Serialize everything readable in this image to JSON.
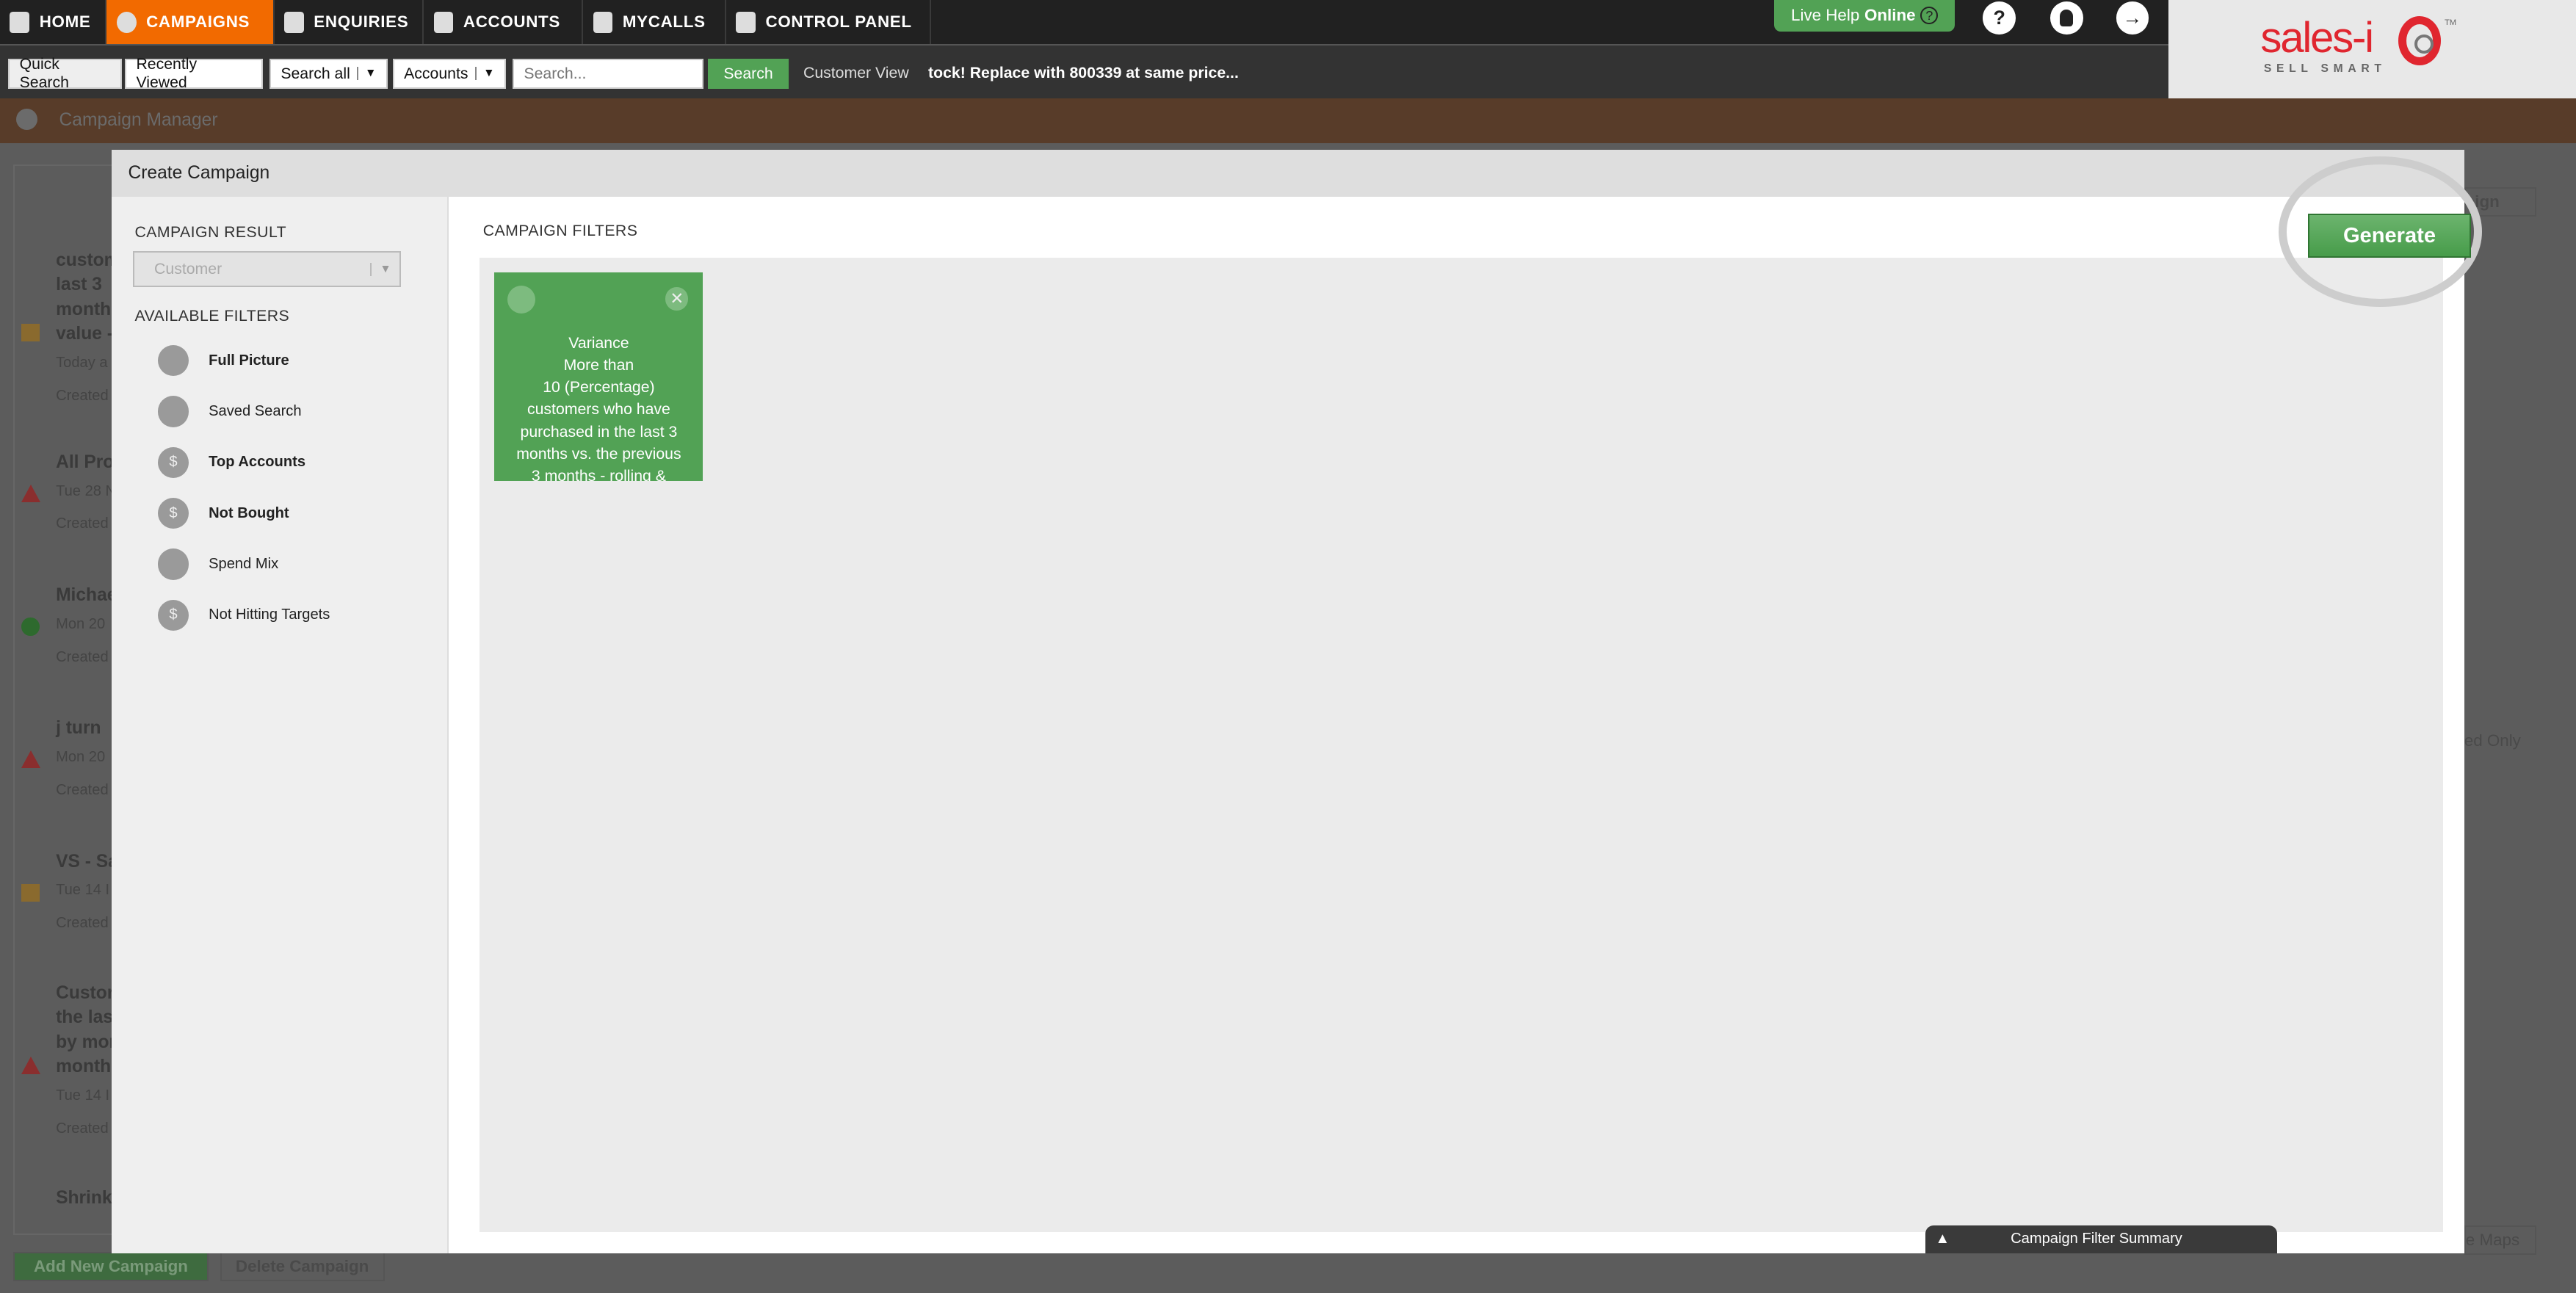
{
  "nav": {
    "items": [
      {
        "label": "HOME",
        "icon": "home-icon"
      },
      {
        "label": "CAMPAIGNS",
        "icon": "campaigns-icon",
        "active": true
      },
      {
        "label": "ENQUIRIES",
        "icon": "enquiries-icon"
      },
      {
        "label": "ACCOUNTS",
        "icon": "accounts-icon"
      },
      {
        "label": "MYCALLS",
        "icon": "mycalls-icon"
      },
      {
        "label": "CONTROL PANEL",
        "icon": "control-panel-icon"
      }
    ],
    "live_help": "Live Help",
    "live_help_status": "Online",
    "help": "?",
    "accent": "#f26a00"
  },
  "search": {
    "quick_search": "Quick Search",
    "recently_viewed": "Recently Viewed",
    "scope": "Search all",
    "entity": "Accounts",
    "placeholder": "Search...",
    "button": "Search",
    "customer_view": "Customer View",
    "ticker": "tock! Replace with 800339 at same price..."
  },
  "logo": {
    "text": "sales-i",
    "tagline": "SELL SMART",
    "tm": "TM"
  },
  "page": {
    "title": "Campaign Manager"
  },
  "background": {
    "campaigns": [
      {
        "title_lines": [
          "custom",
          "last 3",
          "months",
          "value -"
        ],
        "date": "Today a",
        "created": "Created",
        "status": "amber"
      },
      {
        "title_lines": [
          "All Pro"
        ],
        "date": "Tue 28 N",
        "created": "Created",
        "status": "red"
      },
      {
        "title_lines": [
          "Michae"
        ],
        "date": "Mon 20",
        "created": "Created",
        "status": "green"
      },
      {
        "title_lines": [
          "j turn"
        ],
        "date": "Mon 20",
        "created": "Created",
        "status": "red"
      },
      {
        "title_lines": [
          "VS - Sa"
        ],
        "date": "Tue 14 I",
        "created": "Created",
        "status": "amber"
      },
      {
        "title_lines": [
          "Custor",
          "the las",
          "by mor",
          "months"
        ],
        "date": "Tue 14 I",
        "created": "Created",
        "status": "red"
      },
      {
        "title_lines": [
          "Shrink"
        ],
        "date": "",
        "created": "",
        "status": ""
      }
    ],
    "add_new": "Add New Campaign",
    "delete": "Delete Campaign",
    "right_button": "aign",
    "only_label": "ed Only",
    "maps": "e Maps"
  },
  "modal": {
    "title": "Create Campaign",
    "campaign_result_label": "CAMPAIGN RESULT",
    "campaign_result_value": "Customer",
    "available_filters_label": "AVAILABLE FILTERS",
    "filters": [
      {
        "label": "Full Picture",
        "icon": "full-picture-icon"
      },
      {
        "label": "Saved Search",
        "icon": "bank-icon"
      },
      {
        "label": "Top Accounts",
        "icon": "dollar-trend-icon"
      },
      {
        "label": "Not Bought",
        "icon": "dollar-trend-icon"
      },
      {
        "label": "Spend Mix",
        "icon": "spend-mix-icon"
      },
      {
        "label": "Not Hitting Targets",
        "icon": "dollar-trend-icon"
      }
    ],
    "campaign_filters_label": "CAMPAIGN FILTERS",
    "card": {
      "lines": [
        "Variance",
        "More than",
        "10 (Percentage)",
        "customers who have",
        "purchased in the last 3",
        "months vs. the previous",
        "3 months - rolling &"
      ],
      "color": "#52a255"
    },
    "generate": "Generate",
    "summary": "Campaign Filter Summary"
  }
}
